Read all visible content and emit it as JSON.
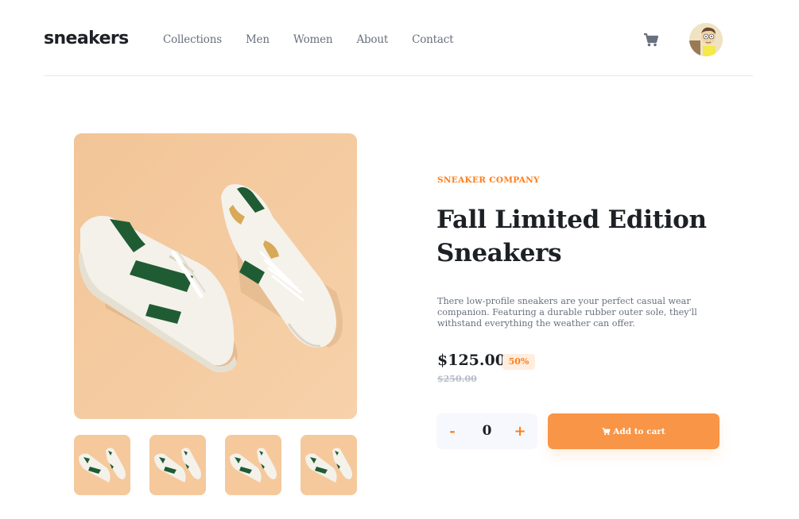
{
  "header": {
    "logo": "sneakers",
    "nav": [
      "Collections",
      "Men",
      "Women",
      "About",
      "Contact"
    ],
    "cart_icon": "cart-icon",
    "avatar": "user-avatar"
  },
  "gallery": {
    "main_image": "sneaker-photo",
    "thumbnails": [
      "thumbnail-1",
      "thumbnail-2",
      "thumbnail-3",
      "thumbnail-4"
    ]
  },
  "product": {
    "company": "SNEAKER COMPANY",
    "title": "Fall Limited Edition Sneakers",
    "description": "There low-profile sneakers are your perfect casual wear companion. Featuring a durable rubber outer sole, they'll withstand everything the weather can offer.",
    "price": "$125.00",
    "discount": "50%",
    "old_price": "$250.00"
  },
  "cart_controls": {
    "minus": "-",
    "quantity": "0",
    "plus": "+",
    "add_label": "Add to cart",
    "add_icon": "cart-icon"
  },
  "colors": {
    "accent": "#ff7e1b",
    "button": "#f89547",
    "text_dark": "#1d2025",
    "text_gray": "#69707d",
    "image_bg": "#f5c99c"
  }
}
